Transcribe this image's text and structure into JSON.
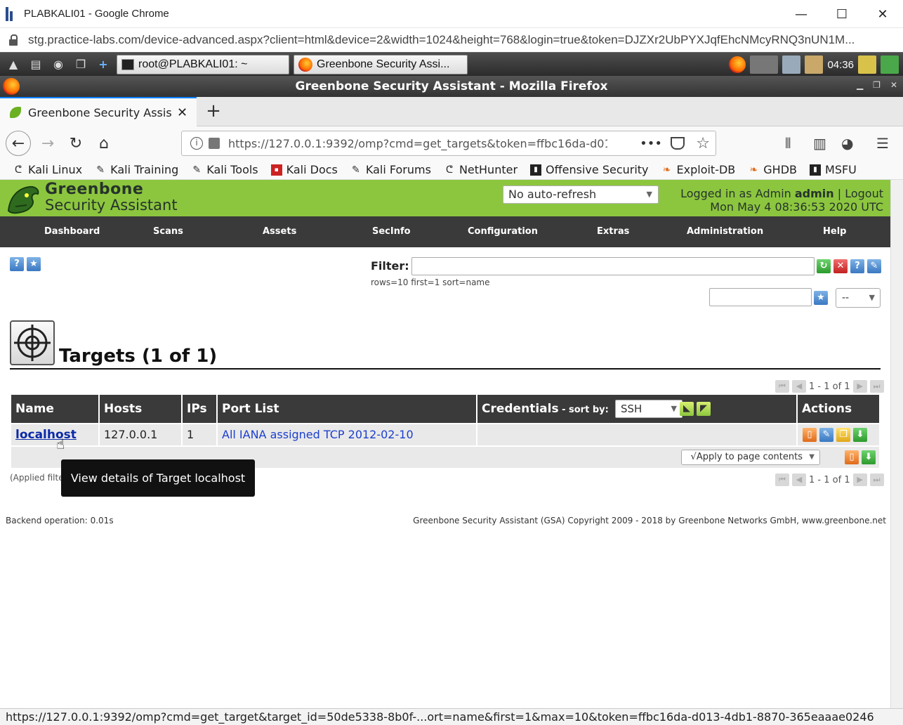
{
  "chrome": {
    "window_title": "PLABKALI01 - Google Chrome",
    "url": "stg.practice-labs.com/device-advanced.aspx?client=html&device=2&width=1024&height=768&login=true&token=DJZXr2UbPYXJqfEhcNMcyRNQ3nUN1M...",
    "minimize": "—",
    "maximize": "☐",
    "close": "✕"
  },
  "kali_panel": {
    "terminal_task": "root@PLABKALI01: ~",
    "firefox_task": "Greenbone Security Assi...",
    "clock": "04:36"
  },
  "firefox": {
    "window_title": "Greenbone Security Assistant - Mozilla Firefox",
    "tab_label": "Greenbone Security Assis",
    "tab_close": "✕",
    "new_tab": "+",
    "url": "https://127.0.0.1:9392/omp?cmd=get_targets&token=ffbc16da-d013",
    "more": "•••",
    "bookmarks": [
      {
        "label": "Kali Linux",
        "icon": "kali-dragon-icon"
      },
      {
        "label": "Kali Training",
        "icon": "kali-tool-icon"
      },
      {
        "label": "Kali Tools",
        "icon": "kali-tool-icon"
      },
      {
        "label": "Kali Docs",
        "icon": "kali-docs-icon"
      },
      {
        "label": "Kali Forums",
        "icon": "kali-tool-icon"
      },
      {
        "label": "NetHunter",
        "icon": "kali-dragon-icon"
      },
      {
        "label": "Offensive Security",
        "icon": "offsec-icon"
      },
      {
        "label": "Exploit-DB",
        "icon": "exploitdb-icon"
      },
      {
        "label": "GHDB",
        "icon": "exploitdb-icon"
      },
      {
        "label": "MSFU",
        "icon": "offsec-icon"
      }
    ],
    "status_url": "https://127.0.0.1:9392/omp?cmd=get_target&target_id=50de5338-8b0f-...ort=name&first=1&max=10&token=ffbc16da-d013-4db1-8870-365eaaae0246"
  },
  "gsa": {
    "brand_line1": "Greenbone",
    "brand_line2": "Security Assistant",
    "refresh_value": "No auto-refresh",
    "login_prefix": "Logged in as  Admin ",
    "login_user": "admin",
    "logout": "Logout",
    "datetime": "Mon May 4 08:36:53 2020 UTC",
    "menu": [
      "Dashboard",
      "Scans",
      "Assets",
      "SecInfo",
      "Configuration",
      "Extras",
      "Administration",
      "Help"
    ],
    "filter_label": "Filter:",
    "filter_value": "",
    "filter_sub": "rows=10 first=1 sort=name",
    "filter_select_value": "--",
    "section_title": "Targets (1 of 1)",
    "pager_text": "1 - 1 of 1",
    "columns": {
      "name": "Name",
      "hosts": "Hosts",
      "ips": "IPs",
      "port_list": "Port List",
      "credentials": "Credentials",
      "sort_by": " - sort by:",
      "sort_value": "SSH",
      "actions": "Actions"
    },
    "rows": [
      {
        "name": "localhost",
        "hosts": "127.0.0.1",
        "ips": "1",
        "port_list": "All IANA assigned TCP 2012-02-10",
        "credentials": ""
      }
    ],
    "apply_label": "√Apply to page contents",
    "applied_prefix": "(Applied filte",
    "tooltip": "View details of Target localhost",
    "backend": "Backend operation: 0.01s",
    "copyright": "Greenbone Security Assistant (GSA) Copyright 2009 - 2018 by Greenbone Networks GmbH, www.greenbone.net"
  }
}
